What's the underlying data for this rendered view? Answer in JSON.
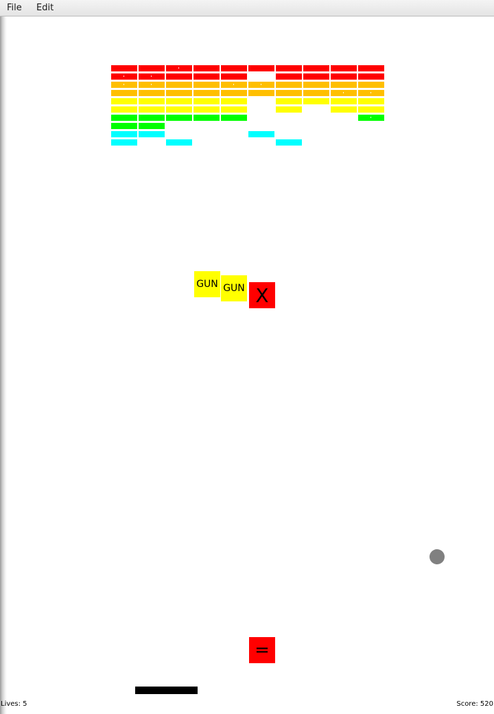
{
  "menu": {
    "file_label": "File",
    "edit_label": "Edit"
  },
  "colors": {
    "red": "#ff0000",
    "orange": "#ffbf00",
    "yellow": "#ffff00",
    "green": "#00ff00",
    "cyan": "#00ffff",
    "ball": "#808080",
    "paddle": "#000000"
  },
  "bricks": {
    "rows": [
      {
        "color": "red",
        "cells": [
          1,
          1,
          1,
          1,
          1,
          1,
          1,
          1,
          1,
          1
        ],
        "marked": [
          0,
          0,
          1,
          0,
          0,
          0,
          0,
          0,
          0,
          0
        ]
      },
      {
        "color": "red",
        "cells": [
          1,
          1,
          1,
          1,
          1,
          0,
          1,
          1,
          1,
          1
        ],
        "marked": [
          1,
          1,
          0,
          0,
          0,
          0,
          0,
          0,
          0,
          0
        ]
      },
      {
        "color": "orange",
        "cells": [
          1,
          1,
          1,
          1,
          1,
          1,
          1,
          1,
          1,
          1
        ],
        "marked": [
          1,
          1,
          0,
          0,
          1,
          1,
          0,
          0,
          0,
          0
        ]
      },
      {
        "color": "orange",
        "cells": [
          1,
          1,
          1,
          1,
          1,
          1,
          1,
          1,
          1,
          1
        ],
        "marked": [
          0,
          0,
          0,
          0,
          0,
          0,
          0,
          0,
          1,
          1
        ]
      },
      {
        "color": "yellow",
        "cells": [
          1,
          1,
          1,
          1,
          1,
          0,
          1,
          1,
          1,
          1
        ],
        "marked": [
          0,
          0,
          0,
          0,
          0,
          0,
          0,
          0,
          0,
          0
        ]
      },
      {
        "color": "yellow",
        "cells": [
          1,
          1,
          1,
          1,
          1,
          0,
          1,
          0,
          1,
          1
        ],
        "marked": [
          0,
          0,
          0,
          0,
          0,
          0,
          0,
          0,
          0,
          0
        ]
      },
      {
        "color": "green",
        "cells": [
          1,
          1,
          1,
          1,
          1,
          0,
          0,
          0,
          0,
          1
        ],
        "marked": [
          0,
          0,
          0,
          0,
          0,
          0,
          0,
          0,
          0,
          1
        ]
      },
      {
        "color": "green",
        "cells": [
          1,
          1,
          0,
          0,
          0,
          0,
          0,
          0,
          0,
          0
        ],
        "marked": [
          0,
          0,
          0,
          0,
          0,
          0,
          0,
          0,
          0,
          0
        ]
      },
      {
        "color": "cyan",
        "cells": [
          1,
          1,
          0,
          0,
          0,
          1,
          0,
          0,
          0,
          0
        ],
        "marked": [
          0,
          0,
          0,
          0,
          0,
          0,
          0,
          0,
          0,
          0
        ]
      },
      {
        "color": "cyan",
        "cells": [
          1,
          0,
          1,
          0,
          0,
          0,
          1,
          0,
          0,
          0
        ],
        "marked": [
          0,
          0,
          0,
          0,
          0,
          0,
          0,
          0,
          0,
          0
        ]
      }
    ]
  },
  "powerups": {
    "gun1_label": "GUN",
    "gun2_label": "GUN",
    "x_label": "X",
    "equal_label": "="
  },
  "status": {
    "lives_text": "Lives: 5",
    "score_text": "Score: 520"
  }
}
